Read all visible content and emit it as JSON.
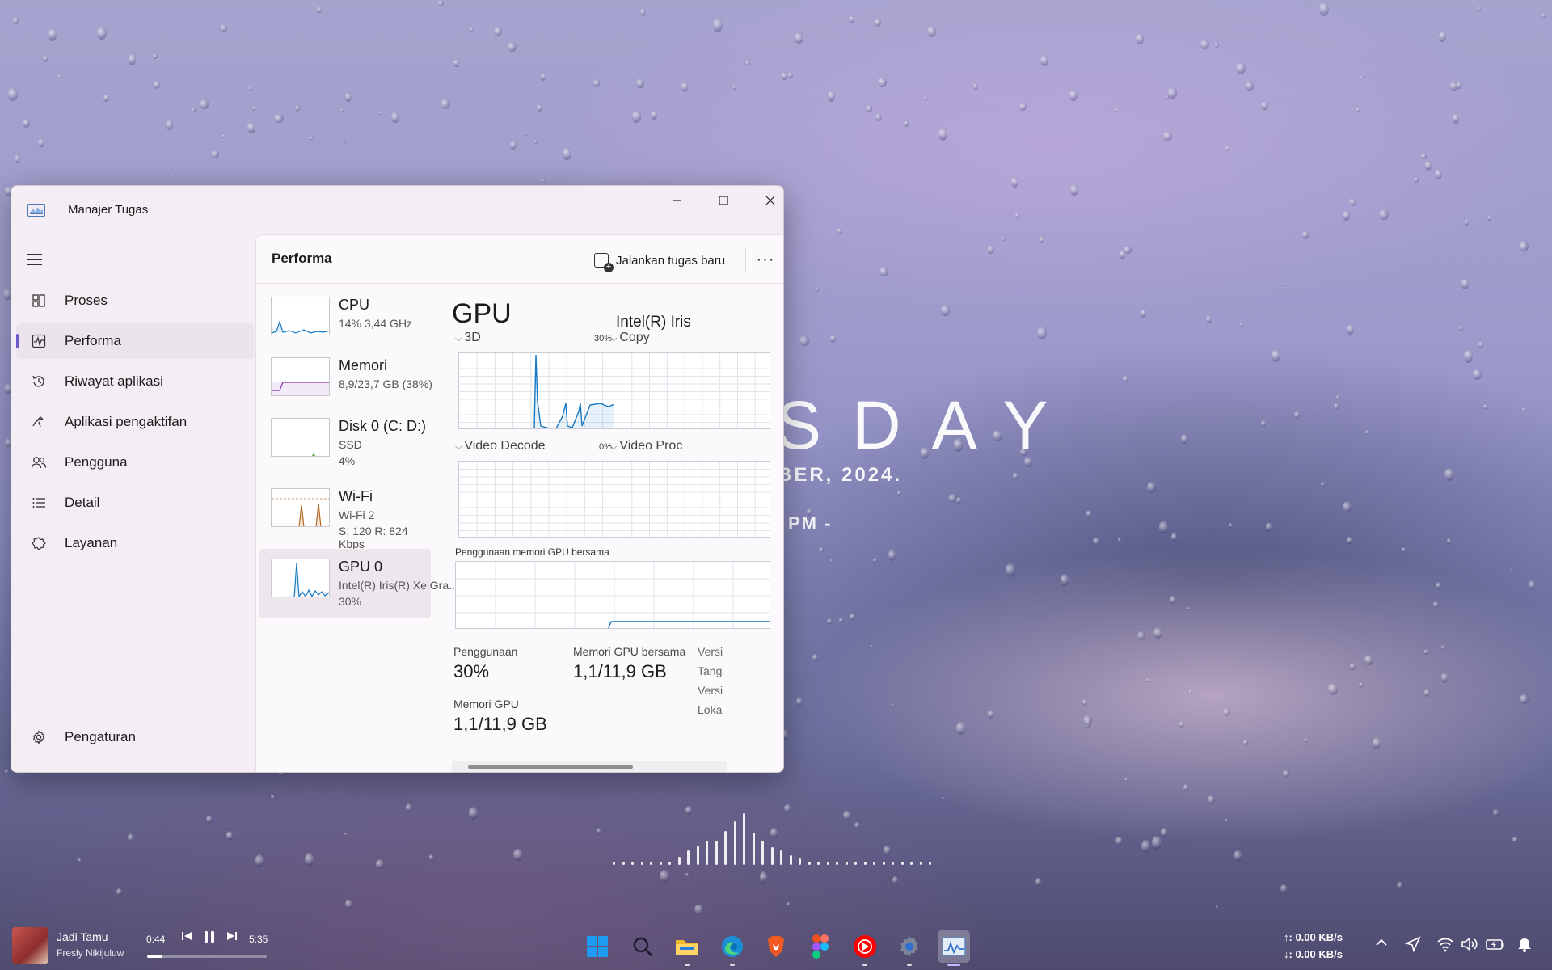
{
  "desktop": {
    "day_text": "SDAY",
    "date_text": "BER, 2024.",
    "time_text": "PM -"
  },
  "window": {
    "title": "Manajer Tugas",
    "controls": {
      "minimize": "—",
      "maximize": "☐",
      "close": "✕"
    }
  },
  "sidebar": {
    "items": [
      {
        "label": "Proses",
        "icon": "processes-icon"
      },
      {
        "label": "Performa",
        "icon": "performance-icon",
        "active": true
      },
      {
        "label": "Riwayat aplikasi",
        "icon": "history-icon"
      },
      {
        "label": "Aplikasi pengaktifan",
        "icon": "startup-icon"
      },
      {
        "label": "Pengguna",
        "icon": "users-icon"
      },
      {
        "label": "Detail",
        "icon": "details-icon"
      },
      {
        "label": "Layanan",
        "icon": "services-icon"
      }
    ],
    "settings": {
      "label": "Pengaturan",
      "icon": "gear-icon"
    }
  },
  "main": {
    "title": "Performa",
    "run_task_label": "Jalankan tugas baru",
    "more_label": "···"
  },
  "devices": [
    {
      "name": "CPU",
      "l1": "14% 3,44 GHz",
      "l2": "",
      "l3": "",
      "color": "#1779c4"
    },
    {
      "name": "Memori",
      "l1": "8,9/23,7 GB (38%)",
      "l2": "",
      "l3": "",
      "color": "#8b2fb5"
    },
    {
      "name": "Disk 0 (C: D:)",
      "l1": "SSD",
      "l2": "4%",
      "l3": "",
      "color": "#4c9a2a"
    },
    {
      "name": "Wi-Fi",
      "l1": "Wi-Fi 2",
      "l2": "S: 120 R: 824 Kbps",
      "l3": "",
      "color": "#b5651d"
    },
    {
      "name": "GPU 0",
      "l1": "Intel(R) Iris(R) Xe Gra...",
      "l2": "30%",
      "l3": "",
      "color": "#1779c4",
      "selected": true
    }
  ],
  "gpu": {
    "title": "GPU",
    "name": "Intel(R) Iris",
    "graphs": {
      "g3d": {
        "label": "3D",
        "pct": "30%"
      },
      "copy": {
        "label": "Copy"
      },
      "vdec": {
        "label": "Video Decode",
        "pct": "0%"
      },
      "vproc": {
        "label": "Video Proc"
      }
    },
    "shared_mem_graph_label": "Penggunaan memori GPU bersama",
    "stats": {
      "usage_label": "Penggunaan",
      "usage_value": "30%",
      "shared_label": "Memori GPU bersama",
      "shared_value": "1,1/11,9 GB",
      "gpu_mem_label": "Memori GPU",
      "gpu_mem_value": "1,1/11,9 GB",
      "side_labels": [
        "Versi",
        "Tang",
        "Versi",
        "Loka"
      ]
    }
  },
  "media": {
    "title": "Jadi Tamu",
    "artist": "Fresly Nikijuluw",
    "elapsed": "0:44",
    "duration": "5:35",
    "progress": 0.13
  },
  "network": {
    "up": "↑: 0.00 KB/s",
    "down": "↓: 0.00 KB/s"
  },
  "taskbar": {
    "apps": [
      "start-icon",
      "search-icon",
      "file-explorer-icon",
      "edge-icon",
      "brave-icon",
      "figma-icon",
      "youtube-music-icon",
      "settings-app-icon",
      "task-manager-icon"
    ],
    "accent": "#6a5bc9"
  }
}
